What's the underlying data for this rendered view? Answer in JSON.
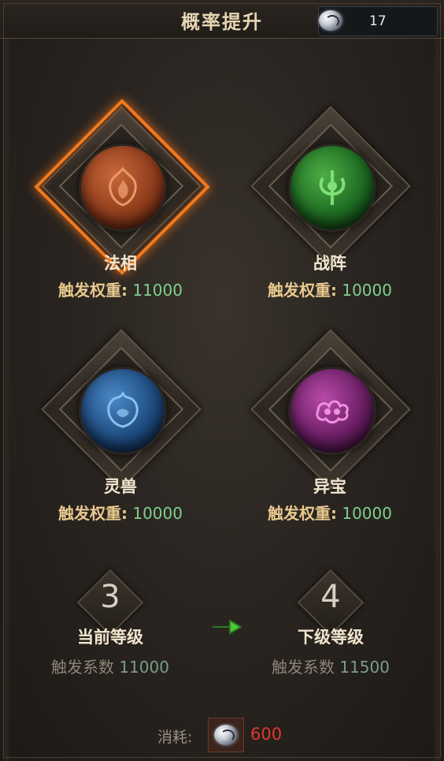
{
  "header": {
    "title": "概率提升",
    "currency_icon": "silver-gem-icon",
    "currency_count": "17"
  },
  "nodes": [
    {
      "name": "法相",
      "weight_label": "触发权重:",
      "weight_value": "11000",
      "orb_color": "#8e3c1c",
      "selected": true,
      "icon": "flame-emblem-icon"
    },
    {
      "name": "战阵",
      "weight_label": "触发权重:",
      "weight_value": "10000",
      "orb_color": "#1e6a22",
      "selected": false,
      "icon": "totem-emblem-icon"
    },
    {
      "name": "灵兽",
      "weight_label": "触发权重:",
      "weight_value": "10000",
      "orb_color": "#1e4a7e",
      "selected": false,
      "icon": "beast-emblem-icon"
    },
    {
      "name": "异宝",
      "weight_label": "触发权重:",
      "weight_value": "10000",
      "orb_color": "#6a1e64",
      "selected": false,
      "icon": "cloud-emblem-icon"
    }
  ],
  "levels": {
    "current": {
      "number": "3",
      "label": "当前等级",
      "coef_label": "触发系数",
      "coef_value": "11000"
    },
    "next": {
      "number": "4",
      "label": "下级等级",
      "coef_label": "触发系数",
      "coef_value": "11500"
    },
    "arrow_icon": "green-arrow-icon"
  },
  "cost": {
    "label": "消耗:",
    "icon": "silver-gem-icon",
    "value": "600",
    "value_color": "#e03a2e"
  },
  "colors": {
    "accent_selected": "#f07a1e",
    "weight_value": "#7fd08c",
    "title": "#e6d5b3"
  }
}
